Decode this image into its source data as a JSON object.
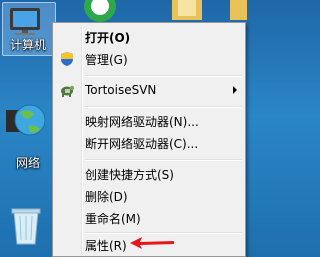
{
  "desktop": {
    "icons": [
      {
        "label": "计算机",
        "selected": true
      },
      {
        "label": "网络",
        "selected": false
      },
      {
        "label": "",
        "selected": false
      }
    ]
  },
  "context_menu": {
    "items": [
      {
        "label": "打开(O)",
        "bold": true,
        "icon": "none"
      },
      {
        "label": "管理(G)",
        "bold": false,
        "icon": "uac-shield-icon"
      },
      {
        "label": "TortoiseSVN",
        "bold": false,
        "icon": "tortoisesvn-icon",
        "submenu": true
      },
      {
        "label": "映射网络驱动器(N)...",
        "bold": false,
        "icon": "none"
      },
      {
        "label": "断开网络驱动器(C)...",
        "bold": false,
        "icon": "none"
      },
      {
        "label": "创建快捷方式(S)",
        "bold": false,
        "icon": "none"
      },
      {
        "label": "删除(D)",
        "bold": false,
        "icon": "none"
      },
      {
        "label": "重命名(M)",
        "bold": false,
        "icon": "none"
      },
      {
        "label": "属性(R)",
        "bold": false,
        "icon": "none"
      }
    ]
  },
  "annotation": {
    "color": "#e8161c",
    "icon": "red-arrow-pointing-left"
  },
  "colors": {
    "menu_bg": "#f0f0f0",
    "desktop_bg": "#2b86c6"
  }
}
